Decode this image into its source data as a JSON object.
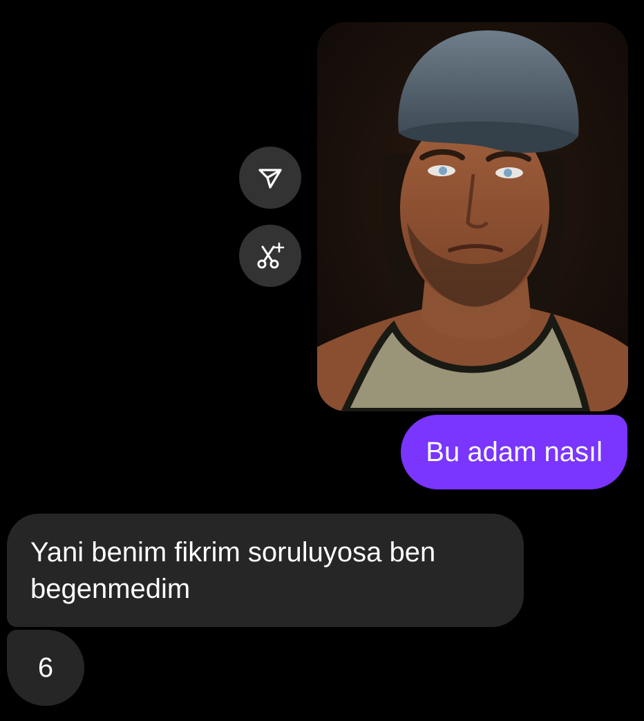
{
  "conversation": {
    "sent_image": {
      "alt": ""
    },
    "sent_text": "Bu adam nasıl",
    "received_messages": [
      {
        "text": "Yani benim fikrim soruluyosa ben begenmedim"
      },
      {
        "text": "6"
      }
    ]
  },
  "actions": {
    "share_icon": "paper-plane-triangle-icon",
    "remix_icon": "scissors-sparkle-icon"
  },
  "colors": {
    "background": "#000000",
    "sent_bubble": "#7a35ff",
    "received_bubble": "#262626",
    "action_button": "#333333"
  }
}
